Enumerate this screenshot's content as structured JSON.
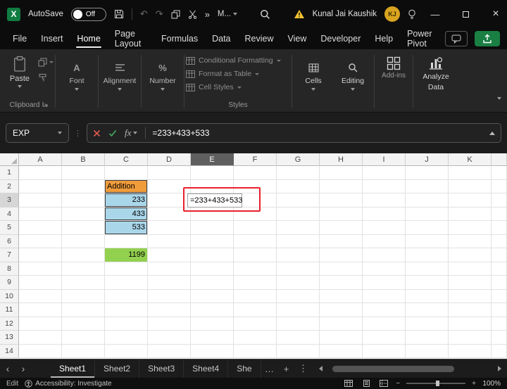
{
  "colors": {
    "accent_green": "#1a7f43",
    "annotation_red": "#e8202c",
    "fill_orange": "#f09c3a",
    "fill_blue": "#aad6ea",
    "fill_green": "#92d050",
    "avatar_gold": "#d9a420",
    "warning_yellow": "#f2c230"
  },
  "icons": {
    "excel_logo": "X",
    "undo": "↶",
    "redo": "↷",
    "overflow_chevrons": "»",
    "more_label": "M...",
    "minimize": "—",
    "close": "×",
    "prev_sheet": "‹",
    "next_sheet": "›",
    "tab_more": "…",
    "add_sheet": "+",
    "tab_menu": "⋮",
    "zoom_out": "−",
    "zoom_in": "+",
    "fx": "fx"
  },
  "titlebar": {
    "autosave_label": "AutoSave",
    "autosave_state": "Off",
    "user_name": "Kunal Jai Kaushik",
    "user_initials": "KJ"
  },
  "menu": {
    "items": [
      "File",
      "Insert",
      "Home",
      "Page Layout",
      "Formulas",
      "Data",
      "Review",
      "View",
      "Developer",
      "Help",
      "Power Pivot"
    ],
    "active": "Home"
  },
  "ribbon": {
    "paste_label": "Paste",
    "clipboard_group_label": "Clipboard",
    "font_label": "Font",
    "font_icon_glyph": "A",
    "number_icon_glyph": "%",
    "alignment_label": "Alignment",
    "number_label": "Number",
    "styles": {
      "items": [
        "Conditional Formatting",
        "Format as Table",
        "Cell Styles"
      ],
      "group_label": "Styles"
    },
    "cells_label": "Cells",
    "editing_label": "Editing",
    "addins_group_label": "Add-ins",
    "analyze_label_line1": "Analyze",
    "analyze_label_line2": "Data"
  },
  "formula_bar": {
    "name_box_value": "EXP",
    "formula": "=233+433+533"
  },
  "grid": {
    "columns": [
      "A",
      "B",
      "C",
      "D",
      "E",
      "F",
      "G",
      "H",
      "I",
      "J",
      "K"
    ],
    "rows": [
      "1",
      "2",
      "3",
      "4",
      "5",
      "6",
      "7",
      "8",
      "9",
      "10",
      "11",
      "12",
      "13",
      "14"
    ],
    "selected_column": "E",
    "selected_row": "3",
    "filled_cells": [
      {
        "ref": "C2",
        "text": "Addition",
        "fill": "#f09c3a",
        "align": "left",
        "bordered": true
      },
      {
        "ref": "C3",
        "text": "233",
        "fill": "#aad6ea",
        "align": "right",
        "bordered": true
      },
      {
        "ref": "C4",
        "text": "433",
        "fill": "#aad6ea",
        "align": "right",
        "bordered": true
      },
      {
        "ref": "C5",
        "text": "533",
        "fill": "#aad6ea",
        "align": "right",
        "bordered": true
      },
      {
        "ref": "C7",
        "text": "1199",
        "fill": "#92d050",
        "align": "right",
        "bordered": false
      }
    ],
    "edit_cell": {
      "ref": "E3",
      "text": "=233+433+533"
    }
  },
  "sheet_tabs": {
    "tabs": [
      "Sheet1",
      "Sheet2",
      "Sheet3",
      "Sheet4",
      "She"
    ],
    "active": "Sheet1"
  },
  "status_bar": {
    "mode": "Edit",
    "accessibility": "Accessibility: Investigate",
    "zoom_level": "100%"
  }
}
